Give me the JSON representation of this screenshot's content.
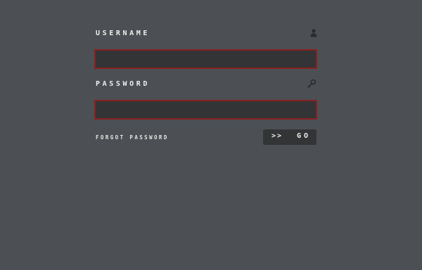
{
  "login": {
    "username": {
      "label": "USERNAME",
      "value": "",
      "icon": "user-icon"
    },
    "password": {
      "label": "PASSWORD",
      "value": "",
      "icon": "key-icon"
    },
    "forgot_label": "FORGOT PASSWORD",
    "submit": {
      "arrows": ">>",
      "label": "GO"
    }
  },
  "colors": {
    "background": "#4c4f53",
    "input_fill": "#333436",
    "input_border": "#8a2020",
    "text": "#efefef",
    "icon": "#2a2b2d"
  }
}
